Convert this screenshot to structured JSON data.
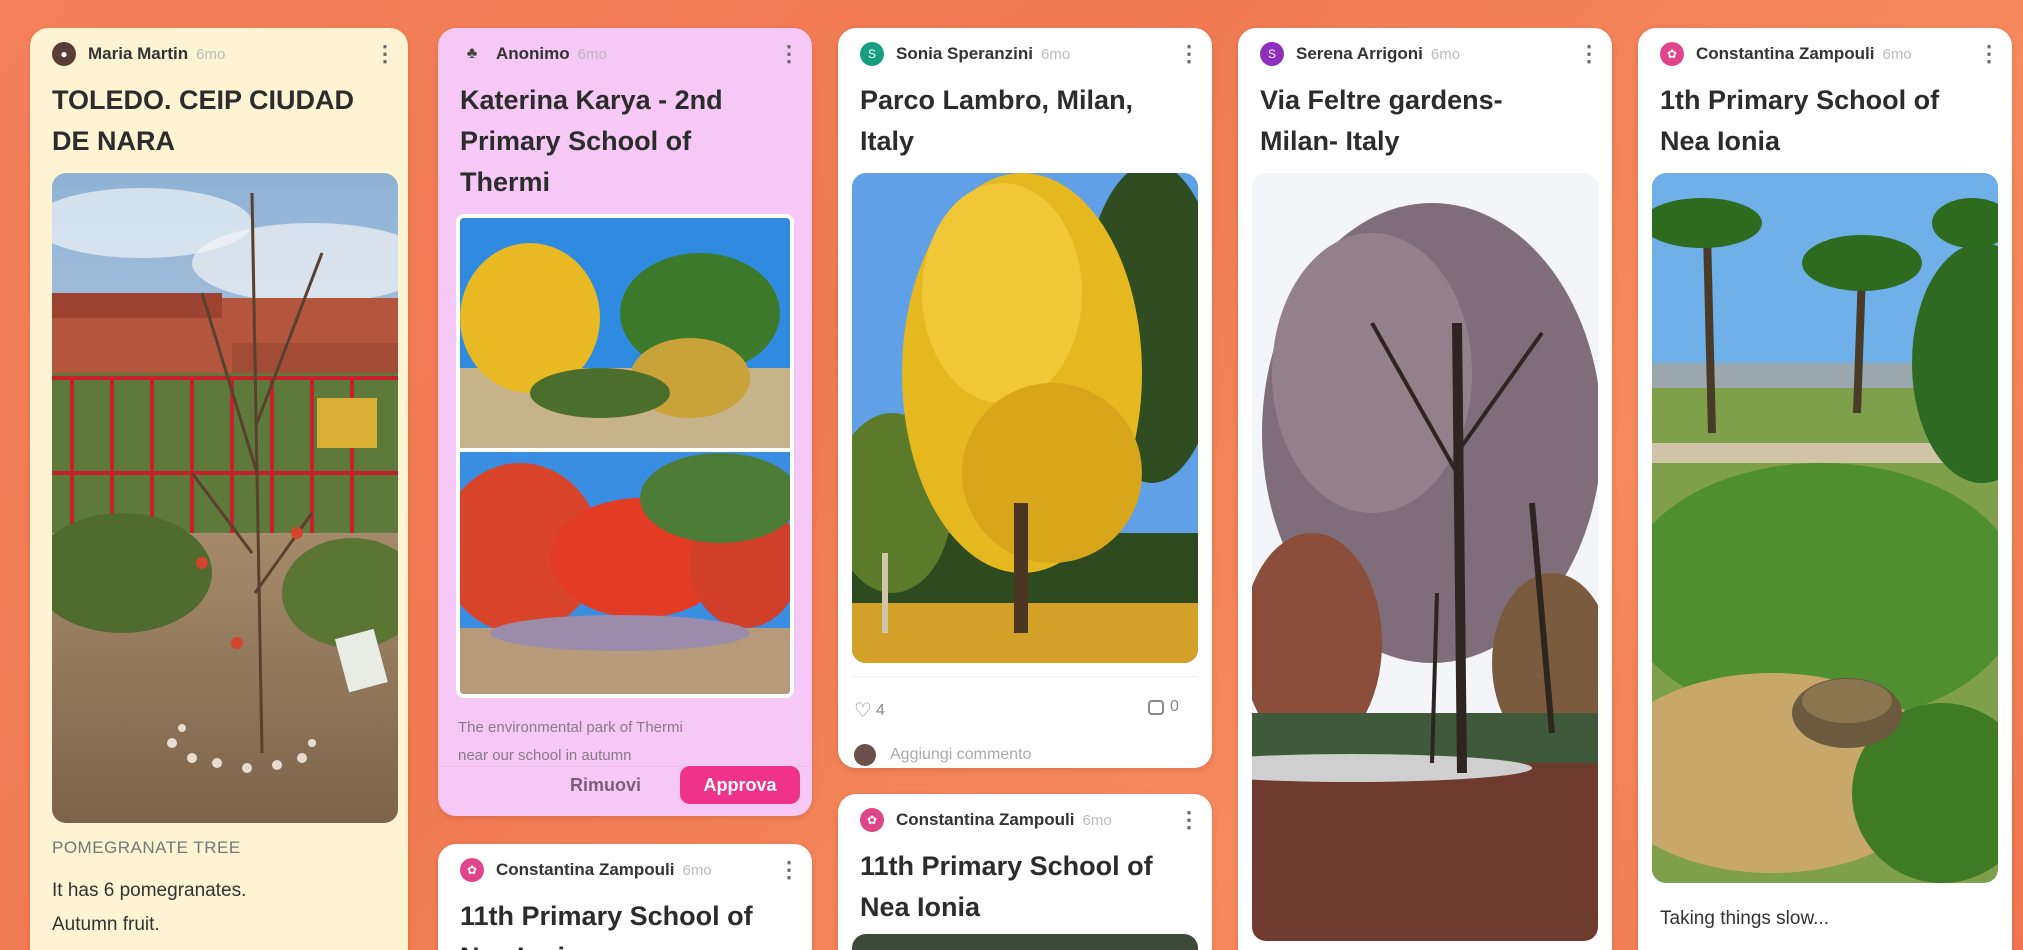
{
  "cards": {
    "c1": {
      "author": "Maria Martin",
      "time": "6mo",
      "title_line1": "TOLEDO. CEIP CIUDAD",
      "title_line2": "DE NARA",
      "subtitle": "POMEGRANATE TREE",
      "body_line1": "It has 6 pomegranates.",
      "body_line2": "Autumn fruit."
    },
    "c2": {
      "author": "Anonimo",
      "time": "6mo",
      "title_line1": "Katerina Karya - 2nd",
      "title_line2": "Primary School of",
      "title_line3": "Thermi",
      "caption_line1": "The environmental park of Thermi",
      "caption_line2": "near our school in autumn",
      "remove_label": "Rimuovi",
      "approve_label": "Approva"
    },
    "c3": {
      "author": "Constantina Zampouli",
      "time": "6mo",
      "title_line1": "11th Primary School of",
      "title_line2": "Nea Ionia"
    },
    "c4": {
      "author": "Sonia Speranzini",
      "time": "6mo",
      "title_line1": "Parco Lambro, Milan,",
      "title_line2": "Italy",
      "likes": "4",
      "comments": "0",
      "add_comment": "Aggiungi commento"
    },
    "c5": {
      "author": "Constantina Zampouli",
      "time": "6mo",
      "title_line1": "11th Primary School of",
      "title_line2": "Nea Ionia"
    },
    "c6": {
      "author": "Serena Arrigoni",
      "time": "6mo",
      "title_line1": "Via Feltre gardens-",
      "title_line2": "Milan- Italy"
    },
    "c7": {
      "author": "Constantina Zampouli",
      "time": "6mo",
      "title_line1": "1th Primary School of",
      "title_line2": "Nea Ionia",
      "body_line1": "Taking things slow..."
    }
  },
  "icons": {
    "menu": "more-vertical-icon",
    "like": "heart-icon",
    "comment": "comment-icon"
  },
  "colors": {
    "background": "#f4815a",
    "approve": "#f0338a",
    "pink_card": "#f5c8f5",
    "yellow_card": "#fef3d2",
    "avatar_teal": "#1a9e82",
    "avatar_purple": "#8e2fbf",
    "avatar_pink": "#e0448a"
  }
}
